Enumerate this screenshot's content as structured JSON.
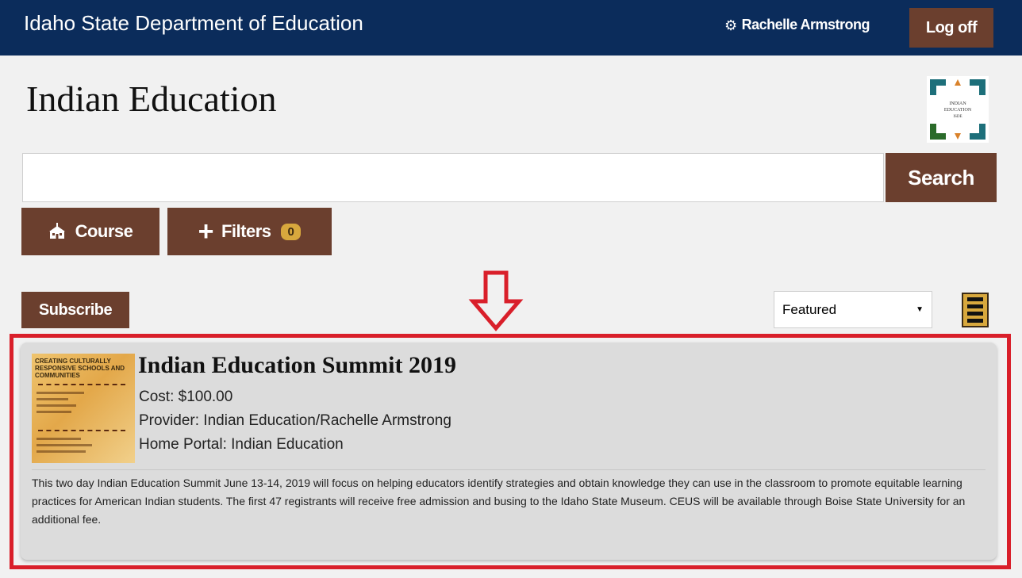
{
  "header": {
    "site_title": "Idaho State Department of Education",
    "user_name": "Rachelle Armstrong",
    "logoff_label": "Log off"
  },
  "page": {
    "title": "Indian Education",
    "logo_text": "INDIAN EDUCATION ISDE"
  },
  "search": {
    "value": "",
    "placeholder": "",
    "button_label": "Search"
  },
  "toolbar": {
    "course_label": "Course",
    "filters_label": "Filters",
    "filters_count": "0",
    "subscribe_label": "Subscribe",
    "sort_selected": "Featured"
  },
  "event": {
    "title": "Indian Education Summit 2019",
    "cost": "Cost: $100.00",
    "provider": "Provider: Indian Education/Rachelle Armstrong",
    "home_portal": "Home Portal: Indian Education",
    "description": "This two day Indian Education Summit June 13-14, 2019 will focus on helping educators identify strategies and obtain knowledge they can use in the classroom to promote equitable learning practices for American Indian students. The first 47 registrants will receive free admission and busing to the Idaho State Museum. CEUS will be available through Boise State University for an additional fee.",
    "thumbnail_text": "Creating Culturally Responsive Schools and Communities"
  },
  "colors": {
    "navy": "#0b2c5b",
    "brown": "#6b3f2e",
    "gold": "#d8a83d",
    "highlight_red": "#d91f2a"
  },
  "icons": {
    "user": "gear-icon",
    "course": "school-icon",
    "filters": "plus-icon",
    "view": "list-view-icon",
    "annotation": "down-arrow-icon"
  }
}
